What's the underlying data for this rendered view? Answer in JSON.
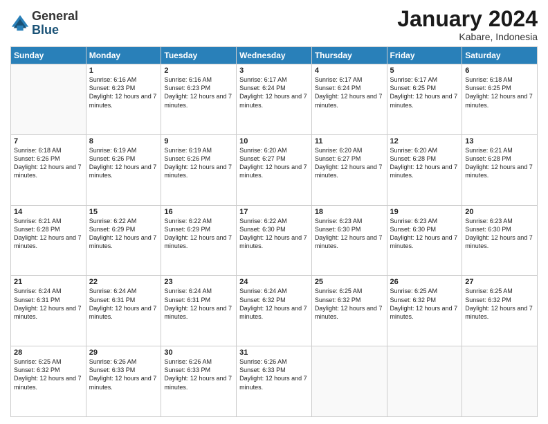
{
  "logo": {
    "general": "General",
    "blue": "Blue"
  },
  "title": "January 2024",
  "subtitle": "Kabare, Indonesia",
  "weekdays": [
    "Sunday",
    "Monday",
    "Tuesday",
    "Wednesday",
    "Thursday",
    "Friday",
    "Saturday"
  ],
  "weeks": [
    [
      {
        "day": "",
        "sunrise": "",
        "sunset": "",
        "daylight": ""
      },
      {
        "day": "1",
        "sunrise": "Sunrise: 6:16 AM",
        "sunset": "Sunset: 6:23 PM",
        "daylight": "Daylight: 12 hours and 7 minutes."
      },
      {
        "day": "2",
        "sunrise": "Sunrise: 6:16 AM",
        "sunset": "Sunset: 6:23 PM",
        "daylight": "Daylight: 12 hours and 7 minutes."
      },
      {
        "day": "3",
        "sunrise": "Sunrise: 6:17 AM",
        "sunset": "Sunset: 6:24 PM",
        "daylight": "Daylight: 12 hours and 7 minutes."
      },
      {
        "day": "4",
        "sunrise": "Sunrise: 6:17 AM",
        "sunset": "Sunset: 6:24 PM",
        "daylight": "Daylight: 12 hours and 7 minutes."
      },
      {
        "day": "5",
        "sunrise": "Sunrise: 6:17 AM",
        "sunset": "Sunset: 6:25 PM",
        "daylight": "Daylight: 12 hours and 7 minutes."
      },
      {
        "day": "6",
        "sunrise": "Sunrise: 6:18 AM",
        "sunset": "Sunset: 6:25 PM",
        "daylight": "Daylight: 12 hours and 7 minutes."
      }
    ],
    [
      {
        "day": "7",
        "sunrise": "Sunrise: 6:18 AM",
        "sunset": "Sunset: 6:26 PM",
        "daylight": "Daylight: 12 hours and 7 minutes."
      },
      {
        "day": "8",
        "sunrise": "Sunrise: 6:19 AM",
        "sunset": "Sunset: 6:26 PM",
        "daylight": "Daylight: 12 hours and 7 minutes."
      },
      {
        "day": "9",
        "sunrise": "Sunrise: 6:19 AM",
        "sunset": "Sunset: 6:26 PM",
        "daylight": "Daylight: 12 hours and 7 minutes."
      },
      {
        "day": "10",
        "sunrise": "Sunrise: 6:20 AM",
        "sunset": "Sunset: 6:27 PM",
        "daylight": "Daylight: 12 hours and 7 minutes."
      },
      {
        "day": "11",
        "sunrise": "Sunrise: 6:20 AM",
        "sunset": "Sunset: 6:27 PM",
        "daylight": "Daylight: 12 hours and 7 minutes."
      },
      {
        "day": "12",
        "sunrise": "Sunrise: 6:20 AM",
        "sunset": "Sunset: 6:28 PM",
        "daylight": "Daylight: 12 hours and 7 minutes."
      },
      {
        "day": "13",
        "sunrise": "Sunrise: 6:21 AM",
        "sunset": "Sunset: 6:28 PM",
        "daylight": "Daylight: 12 hours and 7 minutes."
      }
    ],
    [
      {
        "day": "14",
        "sunrise": "Sunrise: 6:21 AM",
        "sunset": "Sunset: 6:28 PM",
        "daylight": "Daylight: 12 hours and 7 minutes."
      },
      {
        "day": "15",
        "sunrise": "Sunrise: 6:22 AM",
        "sunset": "Sunset: 6:29 PM",
        "daylight": "Daylight: 12 hours and 7 minutes."
      },
      {
        "day": "16",
        "sunrise": "Sunrise: 6:22 AM",
        "sunset": "Sunset: 6:29 PM",
        "daylight": "Daylight: 12 hours and 7 minutes."
      },
      {
        "day": "17",
        "sunrise": "Sunrise: 6:22 AM",
        "sunset": "Sunset: 6:30 PM",
        "daylight": "Daylight: 12 hours and 7 minutes."
      },
      {
        "day": "18",
        "sunrise": "Sunrise: 6:23 AM",
        "sunset": "Sunset: 6:30 PM",
        "daylight": "Daylight: 12 hours and 7 minutes."
      },
      {
        "day": "19",
        "sunrise": "Sunrise: 6:23 AM",
        "sunset": "Sunset: 6:30 PM",
        "daylight": "Daylight: 12 hours and 7 minutes."
      },
      {
        "day": "20",
        "sunrise": "Sunrise: 6:23 AM",
        "sunset": "Sunset: 6:30 PM",
        "daylight": "Daylight: 12 hours and 7 minutes."
      }
    ],
    [
      {
        "day": "21",
        "sunrise": "Sunrise: 6:24 AM",
        "sunset": "Sunset: 6:31 PM",
        "daylight": "Daylight: 12 hours and 7 minutes."
      },
      {
        "day": "22",
        "sunrise": "Sunrise: 6:24 AM",
        "sunset": "Sunset: 6:31 PM",
        "daylight": "Daylight: 12 hours and 7 minutes."
      },
      {
        "day": "23",
        "sunrise": "Sunrise: 6:24 AM",
        "sunset": "Sunset: 6:31 PM",
        "daylight": "Daylight: 12 hours and 7 minutes."
      },
      {
        "day": "24",
        "sunrise": "Sunrise: 6:24 AM",
        "sunset": "Sunset: 6:32 PM",
        "daylight": "Daylight: 12 hours and 7 minutes."
      },
      {
        "day": "25",
        "sunrise": "Sunrise: 6:25 AM",
        "sunset": "Sunset: 6:32 PM",
        "daylight": "Daylight: 12 hours and 7 minutes."
      },
      {
        "day": "26",
        "sunrise": "Sunrise: 6:25 AM",
        "sunset": "Sunset: 6:32 PM",
        "daylight": "Daylight: 12 hours and 7 minutes."
      },
      {
        "day": "27",
        "sunrise": "Sunrise: 6:25 AM",
        "sunset": "Sunset: 6:32 PM",
        "daylight": "Daylight: 12 hours and 7 minutes."
      }
    ],
    [
      {
        "day": "28",
        "sunrise": "Sunrise: 6:25 AM",
        "sunset": "Sunset: 6:32 PM",
        "daylight": "Daylight: 12 hours and 7 minutes."
      },
      {
        "day": "29",
        "sunrise": "Sunrise: 6:26 AM",
        "sunset": "Sunset: 6:33 PM",
        "daylight": "Daylight: 12 hours and 7 minutes."
      },
      {
        "day": "30",
        "sunrise": "Sunrise: 6:26 AM",
        "sunset": "Sunset: 6:33 PM",
        "daylight": "Daylight: 12 hours and 7 minutes."
      },
      {
        "day": "31",
        "sunrise": "Sunrise: 6:26 AM",
        "sunset": "Sunset: 6:33 PM",
        "daylight": "Daylight: 12 hours and 7 minutes."
      },
      {
        "day": "",
        "sunrise": "",
        "sunset": "",
        "daylight": ""
      },
      {
        "day": "",
        "sunrise": "",
        "sunset": "",
        "daylight": ""
      },
      {
        "day": "",
        "sunrise": "",
        "sunset": "",
        "daylight": ""
      }
    ]
  ]
}
